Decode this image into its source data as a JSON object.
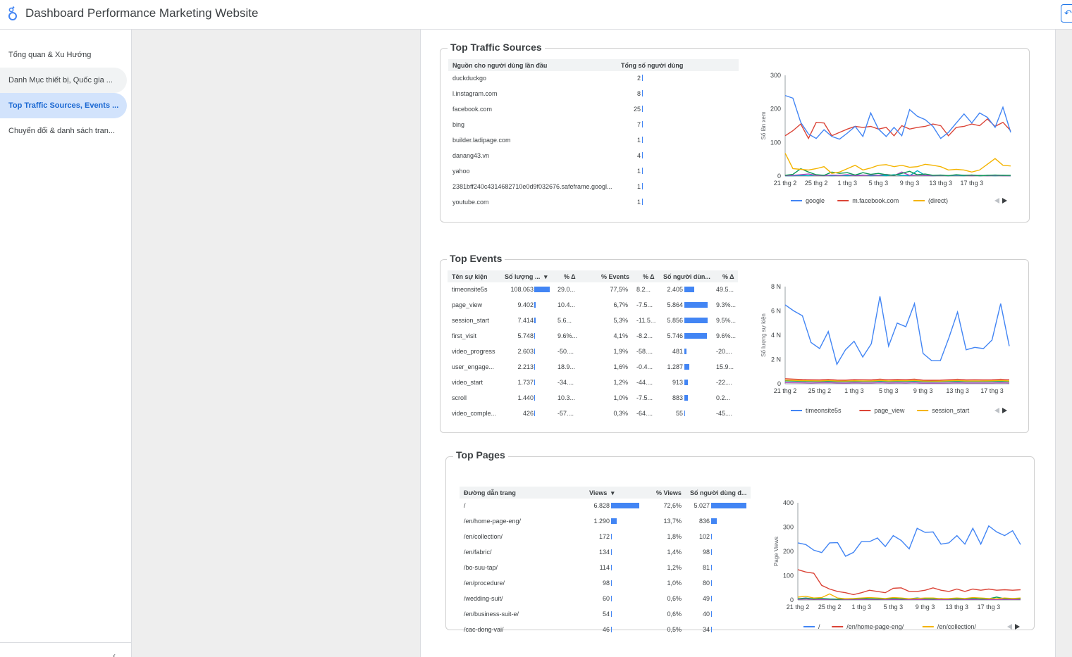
{
  "header": {
    "title": "Dashboard Performance Marketing Website"
  },
  "sidebar": {
    "items": [
      {
        "label": "Tổng quan & Xu Hướng",
        "state": "normal"
      },
      {
        "label": "Danh Mục thiết bị, Quốc gia ...",
        "state": "hover"
      },
      {
        "label": "Top Traffic Sources, Events ...",
        "state": "active"
      },
      {
        "label": "Chuyển đổi & danh sách tran...",
        "state": "normal"
      }
    ]
  },
  "x_ticks": [
    "21 thg 2",
    "25 thg 2",
    "1 thg 3",
    "5 thg 3",
    "9 thg 3",
    "13 thg 3",
    "17 thg 3"
  ],
  "traffic": {
    "title": "Top Traffic Sources",
    "col1": "Nguồn cho người dùng lần đầu",
    "col2": "Tổng số người dùng",
    "rows": [
      {
        "source": "duckduckgo",
        "users": "2"
      },
      {
        "source": "l.instagram.com",
        "users": "8"
      },
      {
        "source": "facebook.com",
        "users": "25"
      },
      {
        "source": "bing",
        "users": "7"
      },
      {
        "source": "builder.ladipage.com",
        "users": "1"
      },
      {
        "source": "danang43.vn",
        "users": "4"
      },
      {
        "source": "yahoo",
        "users": "1"
      },
      {
        "source": "2381bff240c4314682710e0d9f032676.safeframe.googl...",
        "users": "1"
      },
      {
        "source": "youtube.com",
        "users": "1"
      }
    ]
  },
  "events": {
    "title": "Top Events",
    "cols": [
      "Tên sự kiện",
      "Số lượng ...",
      "% Δ",
      "% Events",
      "% Δ",
      "Số người dùn...",
      "% Δ"
    ],
    "rows": [
      {
        "name": "timeonsite5s",
        "count": "108.063",
        "d1": "29.0...",
        "pct": "77,5%",
        "d2": "8.2...",
        "users": "2.405",
        "d3": "49.5...",
        "cbar": 1.0,
        "ubar": 0.41
      },
      {
        "name": "page_view",
        "count": "9.402",
        "d1": "10.4...",
        "pct": "6,7%",
        "d2": "-7.5...",
        "users": "5.864",
        "d3": "9.3%...",
        "cbar": 0.087,
        "ubar": 1.0
      },
      {
        "name": "session_start",
        "count": "7.414",
        "d1": "5.6...",
        "pct": "5,3%",
        "d2": "-11.5...",
        "users": "5.856",
        "d3": "9.5%...",
        "cbar": 0.069,
        "ubar": 0.999
      },
      {
        "name": "first_visit",
        "count": "5.748",
        "d1": "9.6%...",
        "pct": "4,1%",
        "d2": "-8.2...",
        "users": "5.746",
        "d3": "9.6%...",
        "cbar": 0.053,
        "ubar": 0.98
      },
      {
        "name": "video_progress",
        "count": "2.603",
        "d1": "-50....",
        "pct": "1,9%",
        "d2": "-58....",
        "users": "481",
        "d3": "-20....",
        "cbar": 0.024,
        "ubar": 0.082
      },
      {
        "name": "user_engage...",
        "count": "2.213",
        "d1": "18.9...",
        "pct": "1,6%",
        "d2": "-0.4...",
        "users": "1.287",
        "d3": "15.9...",
        "cbar": 0.02,
        "ubar": 0.22
      },
      {
        "name": "video_start",
        "count": "1.737",
        "d1": "-34....",
        "pct": "1,2%",
        "d2": "-44....",
        "users": "913",
        "d3": "-22....",
        "cbar": 0.016,
        "ubar": 0.156
      },
      {
        "name": "scroll",
        "count": "1.440",
        "d1": "10.3...",
        "pct": "1,0%",
        "d2": "-7.5...",
        "users": "883",
        "d3": "0.2...",
        "cbar": 0.013,
        "ubar": 0.15
      },
      {
        "name": "video_comple...",
        "count": "426",
        "d1": "-57....",
        "pct": "0,3%",
        "d2": "-64....",
        "users": "55",
        "d3": "-45....",
        "cbar": 0.004,
        "ubar": 0.009
      }
    ]
  },
  "pages": {
    "title": "Top Pages",
    "cols": [
      "Đường dẫn trang",
      "Views",
      "% Views",
      "Số người dùng đ..."
    ],
    "rows": [
      {
        "path": "/",
        "views": "6.828",
        "pct": "72,6%",
        "users": "5.027",
        "vbar": 1.0,
        "ubar": 1.0
      },
      {
        "path": "/en/home-page-eng/",
        "views": "1.290",
        "pct": "13,7%",
        "users": "836",
        "vbar": 0.189,
        "ubar": 0.166
      },
      {
        "path": "/en/collection/",
        "views": "172",
        "pct": "1,8%",
        "users": "102",
        "vbar": 0.025,
        "ubar": 0.02
      },
      {
        "path": "/en/fabric/",
        "views": "134",
        "pct": "1,4%",
        "users": "98",
        "vbar": 0.02,
        "ubar": 0.02
      },
      {
        "path": "/bo-suu-tap/",
        "views": "114",
        "pct": "1,2%",
        "users": "81",
        "vbar": 0.017,
        "ubar": 0.016
      },
      {
        "path": "/en/procedure/",
        "views": "98",
        "pct": "1,0%",
        "users": "80",
        "vbar": 0.014,
        "ubar": 0.016
      },
      {
        "path": "/wedding-suit/",
        "views": "60",
        "pct": "0,6%",
        "users": "49",
        "vbar": 0.009,
        "ubar": 0.01
      },
      {
        "path": "/en/business-suit-e/",
        "views": "54",
        "pct": "0,6%",
        "users": "40",
        "vbar": 0.008,
        "ubar": 0.008
      },
      {
        "path": "/cac-dong-vai/",
        "views": "46",
        "pct": "0,5%",
        "users": "34",
        "vbar": 0.007,
        "ubar": 0.007
      }
    ]
  },
  "chart_data": [
    {
      "type": "line",
      "ylabel": "Số lần xem",
      "ylim": [
        0,
        300
      ],
      "yticks": [
        "0",
        "100",
        "200",
        "300"
      ],
      "yvals": [
        0,
        100,
        200,
        300
      ],
      "series": [
        {
          "name": "google",
          "color": "#4285f4",
          "values": [
            240,
            232,
            160,
            125,
            112,
            138,
            118,
            110,
            128,
            148,
            118,
            188,
            140,
            118,
            145,
            120,
            198,
            178,
            168,
            148,
            112,
            130,
            158,
            185,
            158,
            188,
            175,
            145,
            205,
            130
          ]
        },
        {
          "name": "m.facebook.com",
          "color": "#db4437",
          "values": [
            120,
            135,
            155,
            112,
            160,
            158,
            120,
            130,
            140,
            148,
            145,
            148,
            140,
            145,
            120,
            150,
            140,
            145,
            148,
            155,
            150,
            120,
            145,
            148,
            155,
            150,
            170,
            148,
            160,
            135
          ]
        },
        {
          "name": "(direct)",
          "color": "#f4b400",
          "values": [
            68,
            22,
            20,
            18,
            22,
            28,
            8,
            12,
            22,
            32,
            18,
            24,
            32,
            34,
            28,
            32,
            26,
            28,
            35,
            32,
            28,
            18,
            20,
            18,
            12,
            18,
            35,
            52,
            32,
            30
          ]
        },
        {
          "color": "#0f9d58",
          "values": [
            2,
            5,
            22,
            12,
            4,
            2,
            12,
            8,
            10,
            3,
            10,
            5,
            8,
            4,
            2,
            8,
            14,
            4,
            6,
            2,
            3,
            1,
            4,
            2,
            3,
            1,
            2,
            3,
            2,
            2
          ]
        },
        {
          "color": "#ab47bc",
          "values": [
            1,
            2,
            4,
            6,
            2,
            1,
            3,
            2,
            4,
            1,
            2,
            3,
            2,
            5,
            1,
            12,
            2,
            3,
            2,
            1,
            2,
            1,
            3,
            2,
            1,
            2,
            1,
            2,
            1,
            1
          ]
        },
        {
          "color": "#00acc1",
          "values": [
            1,
            1,
            2,
            1,
            3,
            2,
            1,
            2,
            1,
            2,
            3,
            1,
            2,
            1,
            4,
            2,
            1,
            16,
            2,
            1,
            2,
            1,
            2,
            1,
            3,
            1,
            2,
            1,
            2,
            1
          ]
        }
      ]
    },
    {
      "type": "line",
      "ylabel": "Số lượng sự kiện",
      "ylim": [
        0,
        8000
      ],
      "yticks": [
        "0",
        "2 N",
        "4 N",
        "6 N",
        "8 N"
      ],
      "yvals": [
        0,
        2000,
        4000,
        6000,
        8000
      ],
      "series": [
        {
          "name": "timeonsite5s",
          "color": "#4285f4",
          "values": [
            6500,
            6000,
            5600,
            3400,
            2900,
            4300,
            1600,
            2800,
            3500,
            2200,
            3300,
            7200,
            3100,
            5000,
            4700,
            6600,
            2500,
            1900,
            1900,
            3800,
            5900,
            2800,
            3000,
            2900,
            3600,
            6600,
            3100
          ]
        },
        {
          "name": "page_view",
          "color": "#db4437",
          "values": [
            420,
            380,
            350,
            330,
            320,
            360,
            310,
            300,
            340,
            330,
            320,
            380,
            330,
            360,
            340,
            380,
            300,
            290,
            300,
            330,
            370,
            320,
            330,
            320,
            330,
            370,
            330
          ]
        },
        {
          "name": "session_start",
          "color": "#f4b400",
          "values": [
            300,
            280,
            260,
            250,
            240,
            270,
            230,
            230,
            250,
            240,
            240,
            280,
            240,
            260,
            250,
            280,
            230,
            220,
            220,
            250,
            270,
            240,
            240,
            240,
            250,
            270,
            240
          ]
        },
        {
          "color": "#0f9d58",
          "values": [
            240,
            220,
            210,
            200,
            190,
            210,
            180,
            180,
            200,
            190,
            190,
            220,
            190,
            210,
            200,
            220,
            180,
            170,
            180,
            200,
            210,
            190,
            190,
            190,
            200,
            210,
            190
          ]
        },
        {
          "color": "#ab47bc",
          "values": [
            100,
            90,
            80,
            70,
            80,
            90,
            70,
            60,
            80,
            70,
            70,
            90,
            70,
            80,
            70,
            90,
            60,
            60,
            60,
            70,
            80,
            70,
            70,
            70,
            70,
            80,
            70
          ]
        }
      ]
    },
    {
      "type": "line",
      "ylabel": "Page Views",
      "ylim": [
        0,
        400
      ],
      "yticks": [
        "0",
        "100",
        "200",
        "300",
        "400"
      ],
      "yvals": [
        0,
        100,
        200,
        300,
        400
      ],
      "series": [
        {
          "name": "/",
          "color": "#4285f4",
          "values": [
            235,
            228,
            205,
            195,
            235,
            236,
            180,
            196,
            240,
            240,
            255,
            220,
            265,
            245,
            210,
            295,
            278,
            280,
            230,
            235,
            265,
            230,
            295,
            230,
            305,
            280,
            265,
            285,
            228
          ]
        },
        {
          "name": "/en/home-page-eng/",
          "color": "#db4437",
          "values": [
            125,
            115,
            110,
            60,
            45,
            35,
            30,
            22,
            30,
            40,
            35,
            30,
            48,
            50,
            35,
            35,
            40,
            50,
            40,
            35,
            45,
            35,
            45,
            40,
            45,
            40,
            42,
            40,
            42
          ]
        },
        {
          "name": "/en/collection/",
          "color": "#f4b400",
          "values": [
            12,
            15,
            8,
            10,
            25,
            8,
            5,
            6,
            8,
            10,
            8,
            6,
            10,
            8,
            5,
            6,
            8,
            8,
            5,
            6,
            8,
            6,
            10,
            8,
            6,
            5,
            8,
            6,
            8
          ]
        },
        {
          "color": "#0f9d58",
          "values": [
            5,
            8,
            4,
            6,
            4,
            3,
            5,
            4,
            6,
            5,
            4,
            5,
            6,
            4,
            5,
            8,
            5,
            4,
            6,
            5,
            4,
            5,
            6,
            4,
            5,
            12,
            5,
            6,
            5
          ]
        },
        {
          "color": "#ab47bc",
          "values": [
            3,
            4,
            2,
            3,
            2,
            2,
            3,
            2,
            3,
            2,
            2,
            3,
            2,
            2,
            3,
            2,
            2,
            3,
            2,
            2,
            3,
            2,
            2,
            3,
            2,
            2,
            3,
            2,
            2
          ]
        }
      ]
    }
  ]
}
